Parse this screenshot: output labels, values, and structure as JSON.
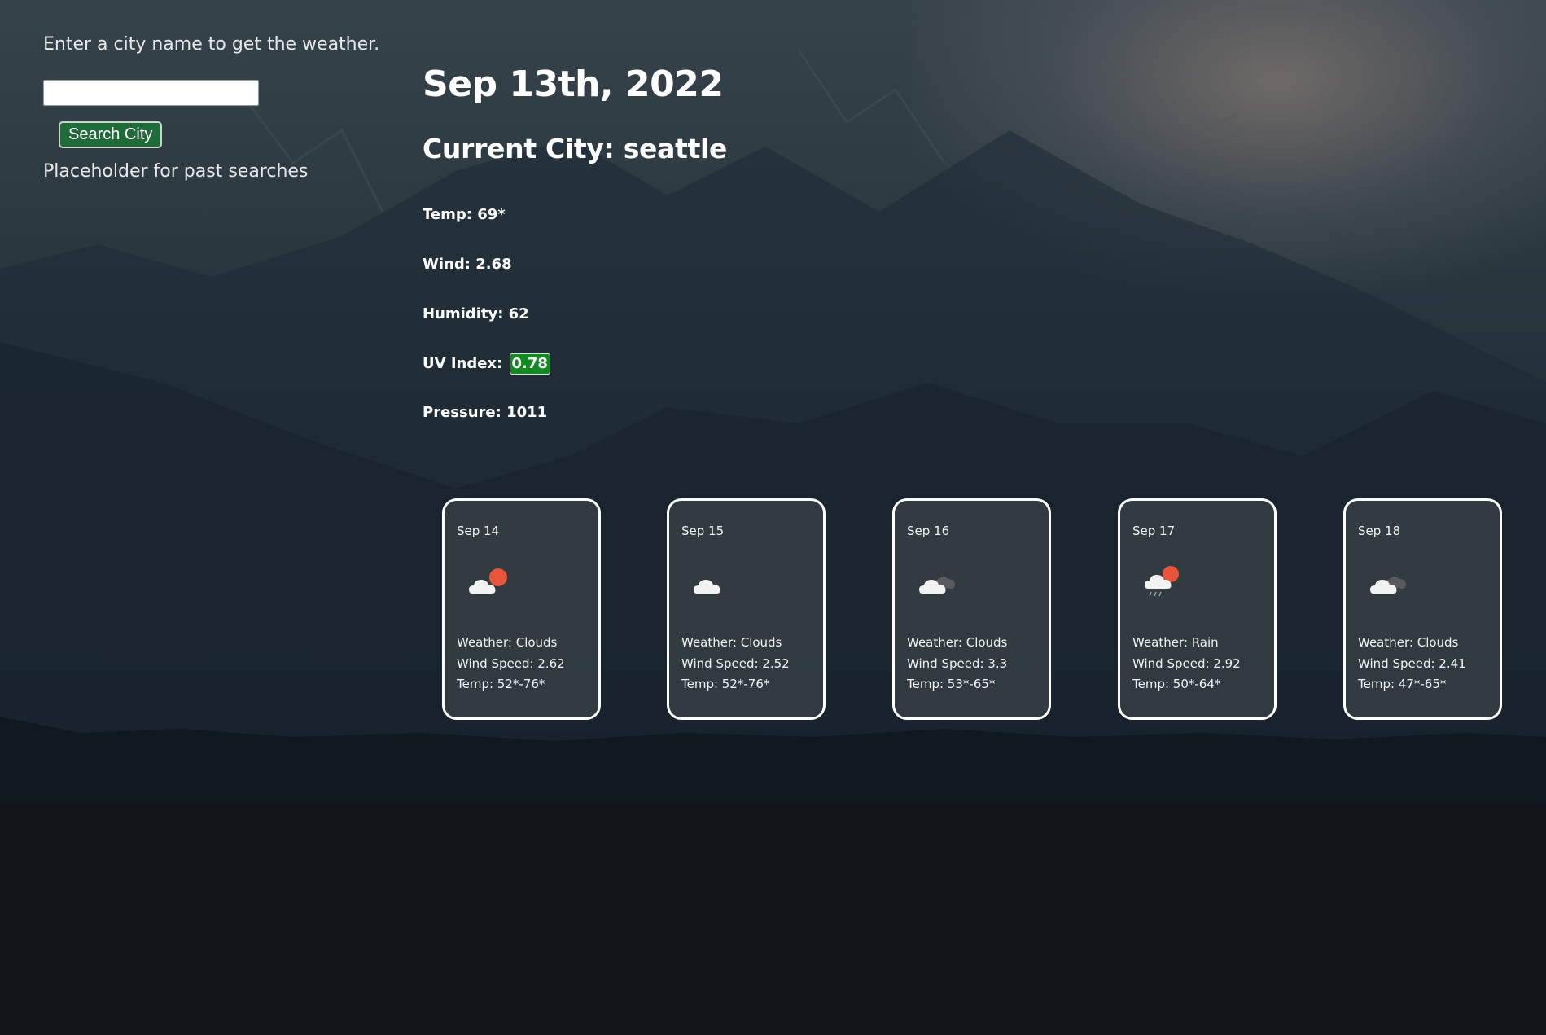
{
  "sidebar": {
    "prompt": "Enter a city name to get the weather.",
    "search_value": "",
    "search_button_label": "Search City",
    "past_searches_placeholder": "Placeholder for past searches"
  },
  "current": {
    "date": "Sep 13th, 2022",
    "city_title": "Current City: seattle",
    "temp": "Temp: 69*",
    "wind": "Wind: 2.68",
    "humidity": "Humidity: 62",
    "uv_label": "UV Index:",
    "uv_value": "0.78",
    "pressure": "Pressure: 1011"
  },
  "forecast": [
    {
      "date": "Sep 14",
      "icon": "partly-cloudy-day-icon",
      "weather": "Weather: Clouds",
      "wind": "Wind Speed: 2.62",
      "temp": "Temp: 52*-76*"
    },
    {
      "date": "Sep 15",
      "icon": "cloud-icon",
      "weather": "Weather: Clouds",
      "wind": "Wind Speed: 2.52",
      "temp": "Temp: 52*-76*"
    },
    {
      "date": "Sep 16",
      "icon": "broken-clouds-icon",
      "weather": "Weather: Clouds",
      "wind": "Wind Speed: 3.3",
      "temp": "Temp: 53*-65*"
    },
    {
      "date": "Sep 17",
      "icon": "rain-sun-icon",
      "weather": "Weather: Rain",
      "wind": "Wind Speed: 2.92",
      "temp": "Temp: 50*-64*"
    },
    {
      "date": "Sep 18",
      "icon": "broken-clouds-icon",
      "weather": "Weather: Clouds",
      "wind": "Wind Speed: 2.41",
      "temp": "Temp: 47*-65*"
    }
  ],
  "colors": {
    "uv_badge": "#128a22",
    "search_button": "#1f6b3a",
    "sun": "#e8553a",
    "cloud": "#f2f2f2",
    "dark_cloud": "#5a5a5e"
  }
}
